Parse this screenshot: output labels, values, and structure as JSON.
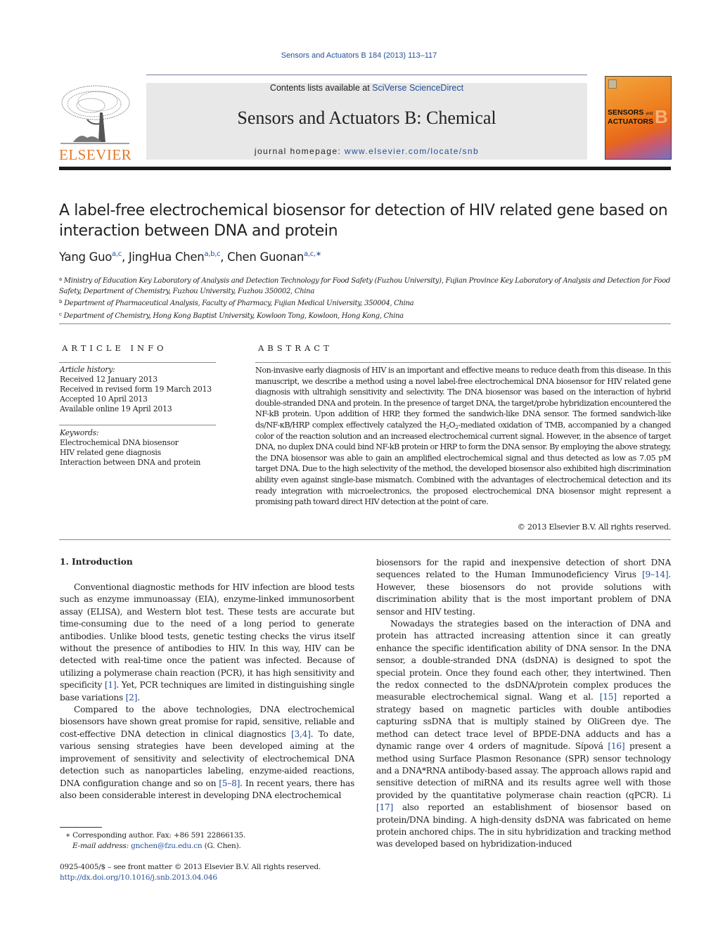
{
  "header": {
    "journal_ref": "Sensors and Actuators B 184 (2013) 113–117",
    "contents_prefix": "Contents lists available at ",
    "contents_link": "SciVerse ScienceDirect",
    "journal_title": "Sensors and Actuators B: Chemical",
    "homepage_prefix": "journal homepage: ",
    "homepage_link": "www.elsevier.com/locate/snb",
    "publisher_logo_text": "ELSEVIER",
    "cover_line1": "SENSORS",
    "cover_and": "and",
    "cover_line2": "ACTUATORS",
    "cover_letter": "B",
    "colors": {
      "link": "#24509a",
      "elsevier_orange": "#e87722",
      "header_box": "#e8e8e8"
    }
  },
  "article": {
    "title": "A label-free electrochemical biosensor for detection of HIV related gene based on interaction between DNA and protein",
    "authors": [
      {
        "name": "Yang Guo",
        "affil": "a,c"
      },
      {
        "name": "JingHua Chen",
        "affil": "a,b,c"
      },
      {
        "name": "Chen Guonan",
        "affil": "a,c,∗"
      }
    ],
    "affiliations": [
      {
        "mark": "a",
        "text": "Ministry of Education Key Laboratory of Analysis and Detection Technology for Food Safety (Fuzhou University), Fujian Province Key Laboratory of Analysis and Detection for Food Safety, Department of Chemistry, Fuzhou University, Fuzhou 350002, China"
      },
      {
        "mark": "b",
        "text": "Department of Pharmaceutical Analysis, Faculty of Pharmacy, Fujian Medical University, 350004, China"
      },
      {
        "mark": "c",
        "text": "Department of Chemistry, Hong Kong Baptist University, Kowloon Tong, Kowloon, Hong Kong, China"
      }
    ]
  },
  "article_info": {
    "label": "ARTICLE INFO",
    "history_label": "Article history:",
    "history": [
      "Received 12 January 2013",
      "Received in revised form 19 March 2013",
      "Accepted 10 April 2013",
      "Available online 19 April 2013"
    ],
    "keywords_label": "Keywords:",
    "keywords": [
      "Electrochemical DNA biosensor",
      "HIV related gene diagnosis",
      "Interaction between DNA and protein"
    ]
  },
  "abstract": {
    "label": "ABSTRACT",
    "text_part1": "Non-invasive early diagnosis of HIV is an important and effective means to reduce death from this disease. In this manuscript, we describe a method using a novel label-free electrochemical DNA biosensor for HIV related gene diagnosis with ultrahigh sensitivity and selectivity. The DNA biosensor was based on the interaction of hybrid double-stranded DNA and protein. In the presence of target DNA, the target/probe hybridization encountered the NF-kB protein. Upon addition of HRP, they formed the sandwich-like DNA sensor. The formed sandwich-like ds/NF-κB/HRP complex effectively catalyzed the H",
    "sub1": "2",
    "text_part2": "O",
    "sub2": "2",
    "text_part3": "-mediated oxidation of TMB, accompanied by a changed color of the reaction solution and an increased electrochemical current signal. However, in the absence of target DNA, no duplex DNA could bind NF-kB protein or HRP to form the DNA sensor. By employing the above strategy, the DNA biosensor was able to gain an amplified electrochemical signal and thus detected as low as 7.05 pM target DNA. Due to the high selectivity of the method, the developed biosensor also exhibited high discrimination ability even against single-base mismatch. Combined with the advantages of electrochemical detection and its ready integration with microelectronics, the proposed electrochemical DNA biosensor might represent a promising path toward direct HIV detection at the point of care.",
    "copyright": "© 2013 Elsevier B.V. All rights reserved."
  },
  "body": {
    "section_heading": "1.  Introduction",
    "left_p1": [
      {
        "t": "Conventional diagnostic methods for HIV infection are blood tests such as enzyme immunoassay (EIA), enzyme-linked immunosorbent assay (ELISA), and Western blot test. These tests are accurate but time-consuming due to the need of a long period to generate antibodies. Unlike blood tests, genetic testing checks the virus itself without the presence of antibodies to HIV. In this way, HIV can be detected with real-time once the patient was infected. Because of utilizing a polymerase chain reaction (PCR), it has high sensitivity and specificity "
      },
      {
        "c": "[1]"
      },
      {
        "t": ". Yet, PCR techniques are limited in distinguishing single base variations "
      },
      {
        "c": "[2]"
      },
      {
        "t": "."
      }
    ],
    "left_p2": [
      {
        "t": "Compared to the above technologies, DNA electrochemical biosensors have shown great promise for rapid, sensitive, reliable and cost-effective DNA detection in clinical diagnostics "
      },
      {
        "c": "[3,4]"
      },
      {
        "t": ". To date, various sensing strategies have been developed aiming at the improvement of sensitivity and selectivity of electrochemical DNA detection such as nanoparticles labeling, enzyme-aided reactions, DNA configuration change and so on "
      },
      {
        "c": "[5–8]"
      },
      {
        "t": ". In recent years, there has also been considerable interest in developing DNA electrochemical"
      }
    ],
    "right_p1": [
      {
        "t": "biosensors for the rapid and inexpensive detection of short DNA sequences related to the Human Immunodeficiency Virus "
      },
      {
        "c": "[9–14]"
      },
      {
        "t": ". However, these biosensors do not provide solutions with discrimination ability that is the most important problem of DNA sensor and HIV testing."
      }
    ],
    "right_p2": [
      {
        "t": "Nowadays the strategies based on the interaction of DNA and protein has attracted increasing attention since it can greatly enhance the specific identification ability of DNA sensor. In the DNA sensor, a double-stranded DNA (dsDNA) is designed to spot the special protein. Once they found each other, they intertwined. Then the redox connected to the dsDNA/protein complex produces the measurable electrochemical signal. Wang et al. "
      },
      {
        "c": "[15]"
      },
      {
        "t": " reported a strategy based on magnetic particles with double antibodies capturing ssDNA that is multiply stained by OliGreen dye. The method can detect trace level of BPDE-DNA adducts and has a dynamic range over 4 orders of magnitude. Sípová "
      },
      {
        "c": "[16]"
      },
      {
        "t": " present a method using Surface Plasmon Resonance (SPR) sensor technology and a DNA*RNA antibody-based assay. The approach allows rapid and sensitive detection of miRNA and its results agree well with those provided by the quantitative polymerase chain reaction (qPCR). Li "
      },
      {
        "c": "[17]"
      },
      {
        "t": " also reported an establishment of biosensor based on protein/DNA binding. A high-density dsDNA was fabricated on heme protein anchored chips. The in situ hybridization and tracking method was developed based on hybridization-induced"
      }
    ]
  },
  "footnotes": {
    "corresponding": "∗  Corresponding author. Fax: +86 591 22866135.",
    "email_label": "E-mail address: ",
    "email": "gnchen@fzu.edu.cn",
    "email_suffix": " (G. Chen).",
    "front_matter": "0925-4005/$ – see front matter © 2013 Elsevier B.V. All rights reserved.",
    "doi": "http://dx.doi.org/10.1016/j.snb.2013.04.046"
  }
}
